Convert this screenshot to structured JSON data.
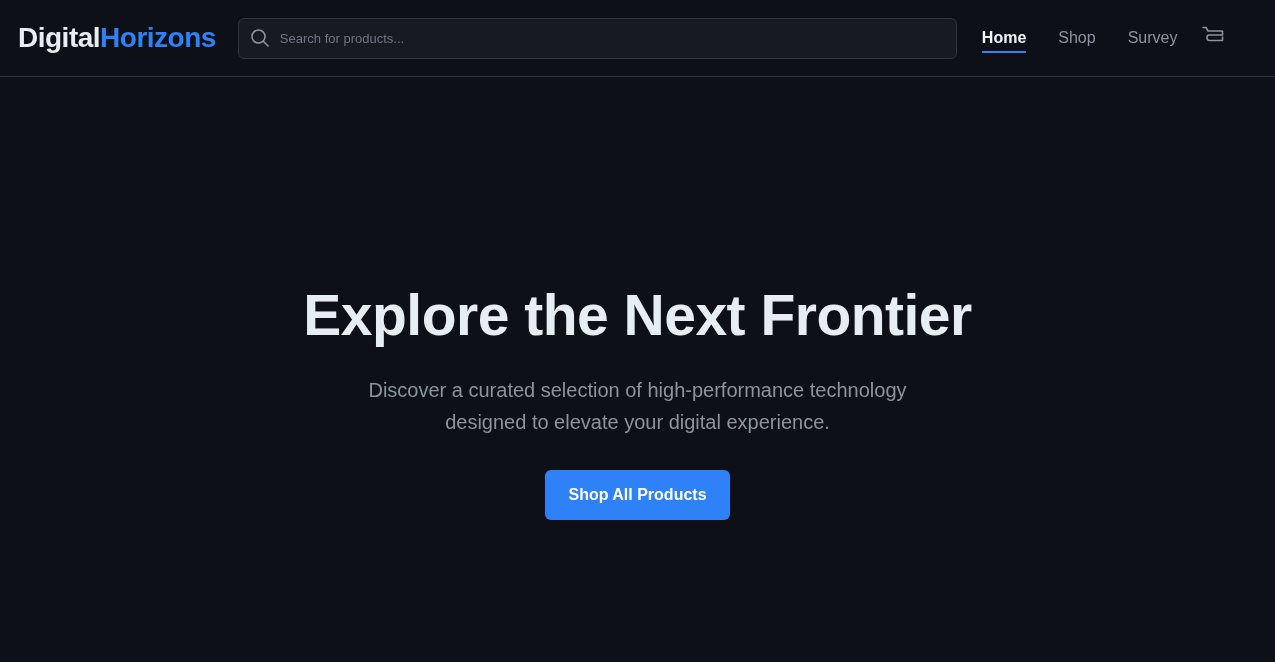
{
  "header": {
    "logo": {
      "part_1": "Digital",
      "part_2": "Horizons"
    },
    "search": {
      "placeholder": "Search for products..."
    },
    "nav": [
      {
        "label": "Home",
        "selected": true
      },
      {
        "label": "Shop",
        "selected": false
      },
      {
        "label": "Survey",
        "selected": false
      }
    ]
  },
  "hero": {
    "title": "Explore the Next Frontier",
    "subtitle": "Discover a curated selection of high-performance technology designed to elevate your digital experience.",
    "button": "Shop All Products"
  }
}
